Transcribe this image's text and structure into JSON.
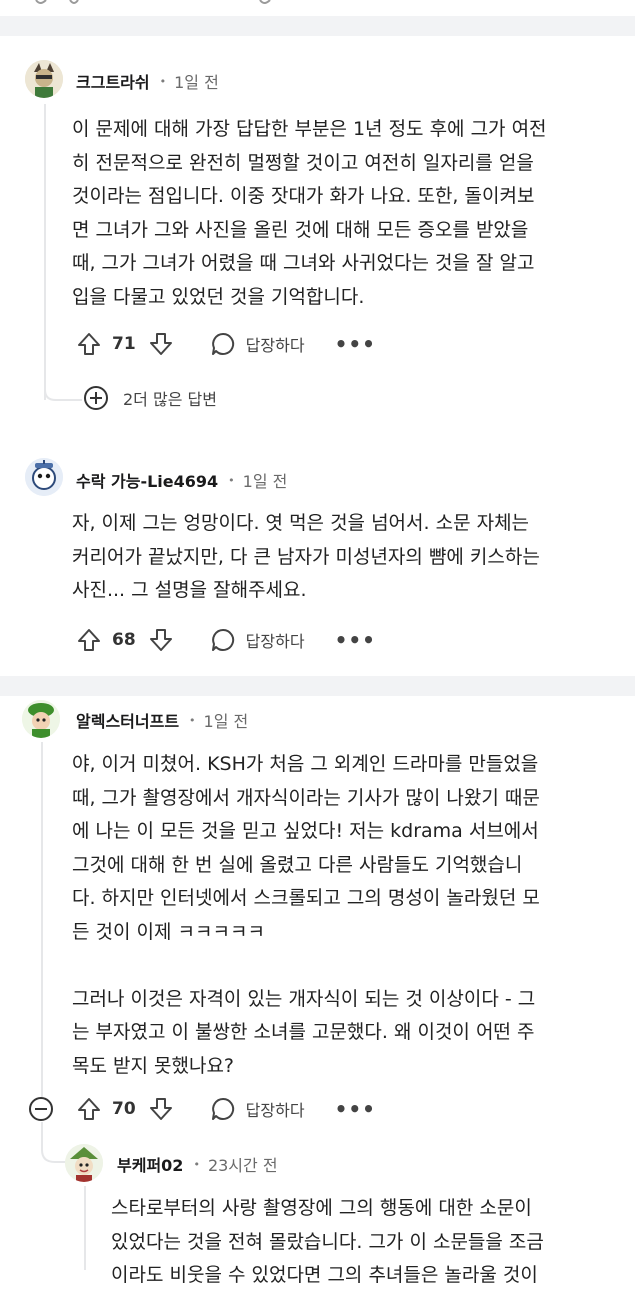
{
  "comments": [
    {
      "username": "크그트라쉬",
      "time": "1일 전",
      "text": "이 문제에 대해 가장 답답한 부분은 1년 정도 후에 그가 여전\n히 전문적으로 완전히 멀쩡할 것이고 여전히 일자리를 얻을\n것이라는 점입니다. 이중 잣대가 화가 나요. 또한, 돌이켜보\n면 그녀가 그와 사진을 올린 것에 대해 모든 증오를 받았을\n때, 그가 그녀가 어렸을 때 그녀와 사귀었다는 것을 잘 알고\n입을 다물고 있었던 것을 기억합니다.",
      "votes": "71",
      "reply_label": "답장하다",
      "more_label": "•••",
      "more_replies": "2더 많은 답변"
    },
    {
      "username": "수락 가능-Lie4694",
      "time": "1일 전",
      "text": "자, 이제 그는 엉망이다. 엿 먹은 것을 넘어서. 소문 자체는\n커리어가 끝났지만, 다 큰 남자가 미성년자의 뺨에 키스하는\n사진... 그 설명을 잘해주세요.",
      "votes": "68",
      "reply_label": "답장하다",
      "more_label": "•••"
    },
    {
      "username": "알렉스터너프트",
      "time": "1일 전",
      "text": "야, 이거 미쳤어. KSH가 처음 그 외계인 드라마를 만들었을\n때, 그가 촬영장에서 개자식이라는 기사가 많이 나왔기 때문\n에 나는 이 모든 것을 믿고 싶었다! 저는 kdrama 서브에서\n그것에 대해 한 번 실에 올렸고 다른 사람들도 기억했습니\n다. 하지만 인터넷에서 스크롤되고 그의 명성이 놀라웠던 모\n든 것이 이제 ㅋㅋㅋㅋㅋ\n\n그러나 이것은 자격이 있는 개자식이 되는 것 이상이다 - 그\n는 부자였고 이 불쌍한 소녀를 고문했다. 왜 이것이 어떤 주\n목도 받지 못했나요?",
      "votes": "70",
      "reply_label": "답장하다",
      "more_label": "•••"
    },
    {
      "username": "부케퍼02",
      "time": "23시간 전",
      "text": "스타로부터의 사랑 촬영장에 그의 행동에 대한 소문이\n있었다는 것을 전혀 몰랐습니다. 그가 이 소문들을 조금\n이라도 비웃을 수 있었다면 그의 추녀들은 놀라울 것이"
    }
  ],
  "colors": {
    "separator": "#f2f3f5",
    "thread_line": "#e6e7e9",
    "text": "#222222",
    "muted": "#6a6a6a"
  },
  "icons": [
    "upvote-icon",
    "downvote-icon",
    "reply-bubble-icon",
    "more-icon",
    "plus-circle-icon",
    "minus-circle-icon"
  ]
}
